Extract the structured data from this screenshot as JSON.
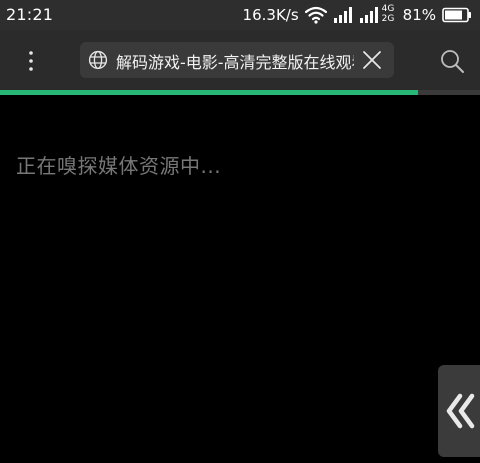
{
  "status_bar": {
    "time": "21:21",
    "net_speed": "16.3K/s",
    "network_badge_top": "4G",
    "network_badge_bottom": "2G",
    "battery_percent": "81%",
    "battery_level": 0.81
  },
  "top_bar": {
    "url_title": "解码游戏-电影-高清完整版在线观看",
    "icons": {
      "menu": "more-vertical-icon",
      "globe": "globe-icon",
      "close": "close-icon",
      "search": "search-icon"
    }
  },
  "progress": {
    "value": 0.87,
    "color": "#27b877"
  },
  "content": {
    "message": "正在嗅探媒体资源中..."
  },
  "side_tab": {
    "icon": "double-chevron-left-icon"
  }
}
